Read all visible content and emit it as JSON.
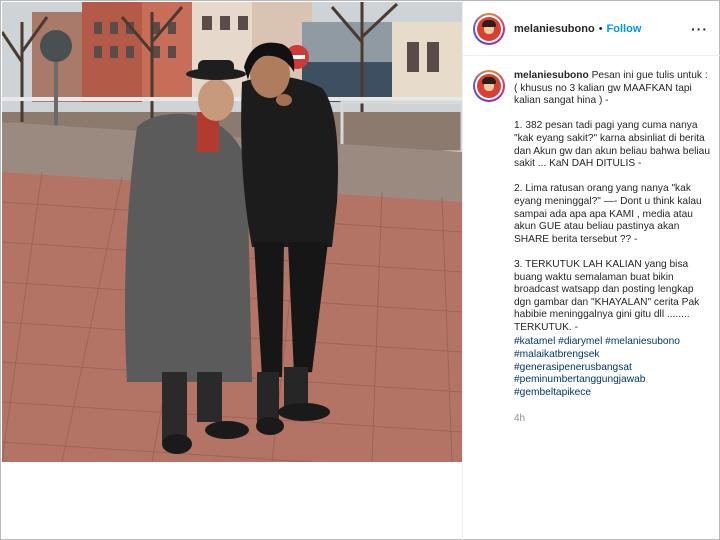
{
  "post": {
    "username": "melaniesubono",
    "separator": "•",
    "follow_label": "Follow",
    "more_icon": "more-options-icon",
    "more_glyph": "···",
    "caption_username": "melaniesubono",
    "caption_text": " Pesan ini gue tulis untuk :( khusus no 3 kalian gw MAAFKAN tapi kalian sangat hina ) -\n\n1. 382 pesan tadi pagi yang cuma nanya \"kak eyang sakit?\" karna absinliat di berita dan Akun gw dan akun beliau bahwa beliau sakit ... KaN DAH DITULIS -\n\n2. Lima ratusan orang yang nanya \"kak eyang meninggal?\" —- Dont u think kalau sampai ada apa apa KAMI , media atau akun GUE atau beliau pastinya akan SHARE berita tersebut ?? -\n\n3. TERKUTUK LAH KALIAN yang bisa buang waktu semalaman buat bikin broadcast watsapp dan posting lengkap dgn gambar dan \"KHAYALAN\" cerita Pak habibie meninggalnya gini gitu dll ........ TERKUTUK. -\n",
    "hashtags": [
      "#katamel #diarymel #melaniesubono",
      "#malaikatbrengsek",
      "#generasipenerusbangsat",
      "#peminumbertanggungjawab",
      "#gembeltapikece"
    ],
    "time_ago": "4h"
  },
  "colors": {
    "link_blue": "#0095f6",
    "hashtag": "#00376b",
    "muted": "#8e8e8e"
  }
}
